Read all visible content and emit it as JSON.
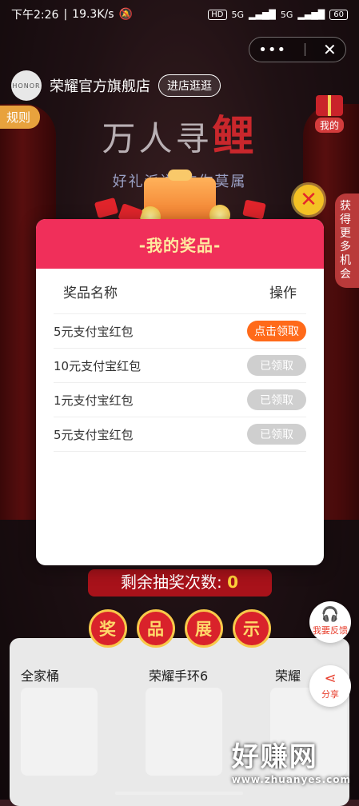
{
  "status_bar": {
    "time": "下午2:26",
    "speed": "19.3K/s",
    "hd": "HD",
    "net1": "5G",
    "net2": "5G",
    "battery": "60"
  },
  "header": {
    "shop_logo_text": "HONOR",
    "shop_name": "荣耀官方旗舰店",
    "enter_shop": "进店逛逛",
    "rules": "规则",
    "my": "我的",
    "title_part1": "万人寻",
    "title_part2": "鲤",
    "subtitle": "好礼派送 非你莫属",
    "side_tab": "获得更多机会"
  },
  "modal": {
    "title": "-我的奖品-",
    "col_name": "奖品名称",
    "col_action": "操作",
    "rows": [
      {
        "name": "5元支付宝红包",
        "action": "点击领取"
      },
      {
        "name": "10元支付宝红包",
        "action": "已领取"
      },
      {
        "name": "1元支付宝红包",
        "action": "已领取"
      },
      {
        "name": "5元支付宝红包",
        "action": "已领取"
      }
    ]
  },
  "bottom": {
    "remain_label": "剩余抽奖次数:",
    "remain_count": "0",
    "show_chars": [
      "奖",
      "品",
      "展",
      "示"
    ],
    "products": [
      "全家桶",
      "荣耀手环6",
      "荣耀"
    ],
    "feedback": "我要反馈",
    "share": "分享"
  },
  "watermark": {
    "main": "好赚网",
    "url": "www.zhuanyes.com"
  },
  "colors": {
    "modal_header": "#f02f5a",
    "claim_button": "#ff6a1a",
    "claimed_button": "#cfcfcf",
    "close_button": "#f4c124"
  }
}
